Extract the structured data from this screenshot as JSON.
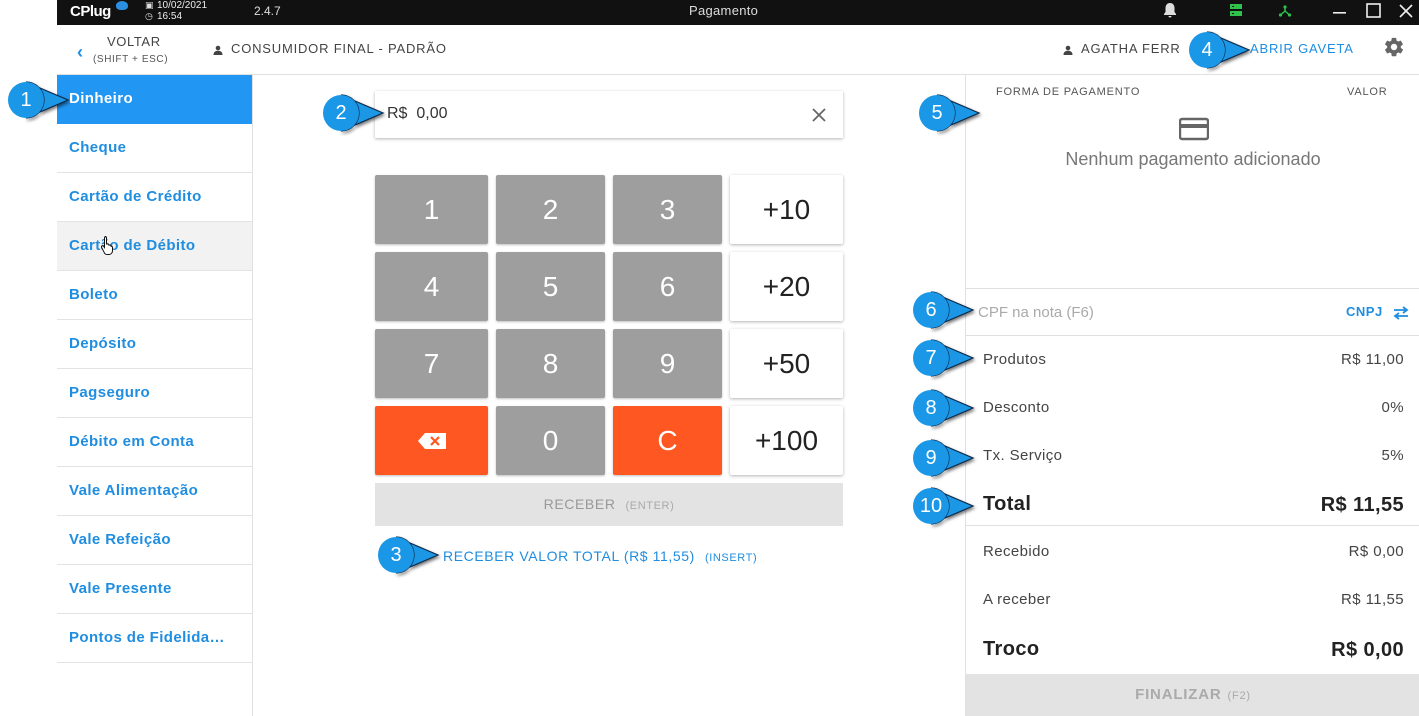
{
  "titlebar": {
    "logo": "CPlug",
    "date": "10/02/2021",
    "time": "16:54",
    "version": "2.4.7",
    "title": "Pagamento",
    "icons": [
      "bell-icon",
      "network-icon",
      "sync-icon"
    ],
    "window_controls": [
      "minimize",
      "maximize",
      "close"
    ]
  },
  "header": {
    "back_label": "VOLTAR",
    "back_shortcut": "(SHIFT + ESC)",
    "consumer": "CONSUMIDOR FINAL - PADRÃO",
    "user": "AGATHA FERR",
    "drawer_label": "ABRIR GAVETA"
  },
  "sidebar": {
    "items": [
      {
        "label": "Dinheiro",
        "active": true
      },
      {
        "label": "Cheque"
      },
      {
        "label": "Cartão de Crédito"
      },
      {
        "label": "Cartão de Débito"
      },
      {
        "label": "Boleto"
      },
      {
        "label": "Depósito"
      },
      {
        "label": "Pagseguro"
      },
      {
        "label": "Débito em Conta"
      },
      {
        "label": "Vale Alimentação"
      },
      {
        "label": "Vale Refeição"
      },
      {
        "label": "Vale Presente"
      },
      {
        "label": "Pontos de Fidelida…"
      }
    ]
  },
  "payment": {
    "currency": "R$",
    "amount": "0,00",
    "keys": [
      "1",
      "2",
      "3",
      "+10",
      "4",
      "5",
      "6",
      "+20",
      "7",
      "8",
      "9",
      "+50",
      "",
      "0",
      "C",
      "+100"
    ],
    "receive_label": "RECEBER",
    "receive_shortcut": "(ENTER)",
    "receive_total_label": "RECEBER VALOR TOTAL (R$ 11,55)",
    "receive_total_shortcut": "(INSERT)"
  },
  "summary": {
    "col_method": "FORMA DE PAGAMENTO",
    "col_value": "VALOR",
    "empty": "Nenhum pagamento adicionado",
    "cpf_placeholder": "CPF na nota (F6)",
    "cnpj_label": "CNPJ",
    "rows": {
      "produtos": {
        "label": "Produtos",
        "value": "R$ 11,00"
      },
      "desconto": {
        "label": "Desconto",
        "value": "0%"
      },
      "servico": {
        "label": "Tx. Serviço",
        "value": "5%"
      },
      "total": {
        "label": "Total",
        "value": "R$ 11,55"
      },
      "recebido": {
        "label": "Recebido",
        "value": "R$ 0,00"
      },
      "areceber": {
        "label": "A receber",
        "value": "R$ 11,55"
      },
      "troco": {
        "label": "Troco",
        "value": "R$ 0,00"
      }
    },
    "finish_label": "FINALIZAR",
    "finish_shortcut": "(F2)"
  },
  "callouts": [
    "1",
    "2",
    "3",
    "4",
    "5",
    "6",
    "7",
    "8",
    "9",
    "10"
  ],
  "colors": {
    "accent": "#1f8de0",
    "active": "#2196f3",
    "orange": "#ff5722",
    "key_gray": "#9e9e9e",
    "callout": "#1a97e6"
  }
}
